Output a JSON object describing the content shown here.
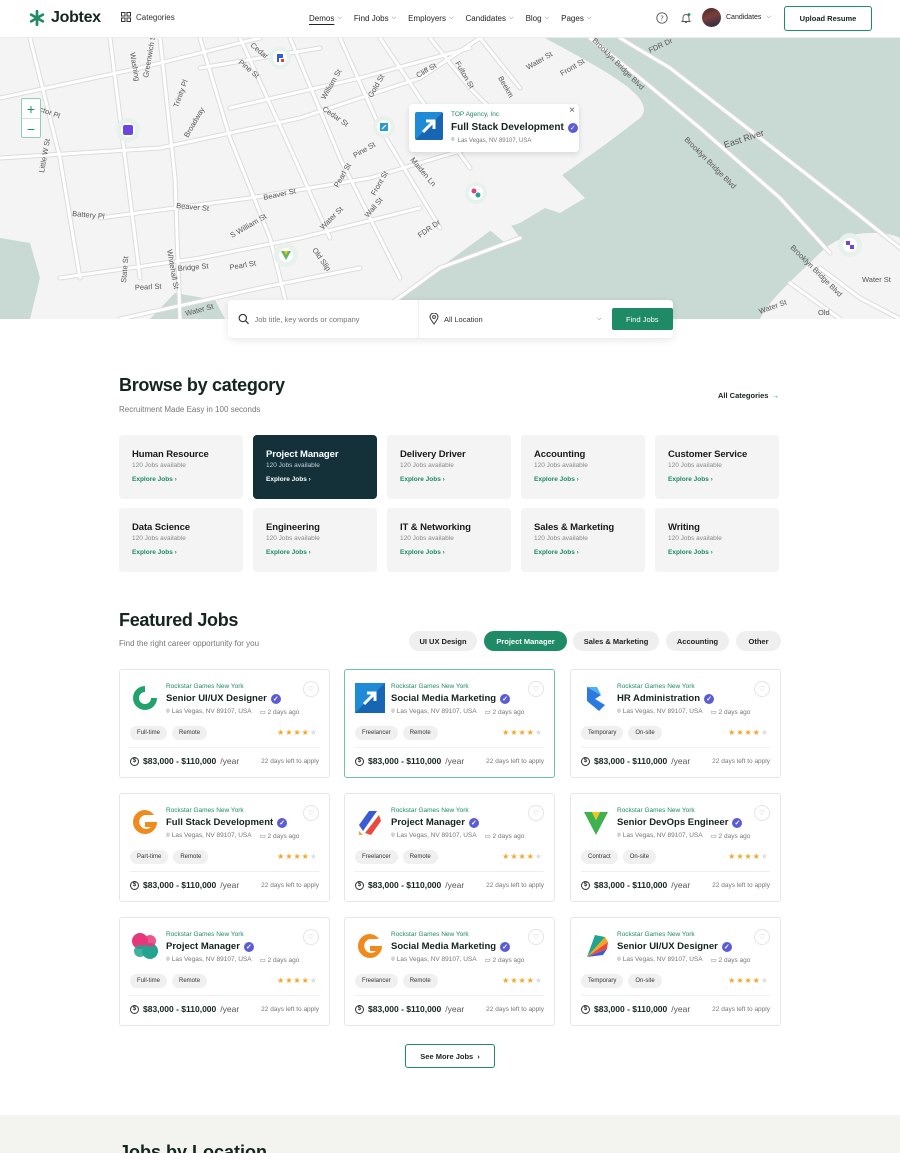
{
  "header": {
    "logo_text": "Jobtex",
    "categories_label": "Categories",
    "nav": [
      {
        "label": "Demos"
      },
      {
        "label": "Find Jobs"
      },
      {
        "label": "Employers"
      },
      {
        "label": "Candidates"
      },
      {
        "label": "Blog"
      },
      {
        "label": "Pages"
      }
    ],
    "user_label": "Candidates",
    "upload_button": "Upload Resume",
    "icons": {
      "categories": "grid-icon",
      "help": "question-circle-icon",
      "bell": "bell-icon",
      "avatar": "user-avatar"
    }
  },
  "map": {
    "popup": {
      "company": "TOP Agency, Inc",
      "title": "Full Stack Development",
      "location": "Las Vegas, NV 89107, USA"
    },
    "streets": [
      "Washing",
      "Greenwich St",
      "Trinity Pl",
      "Broadway",
      "Cedar",
      "Pine St",
      "William St",
      "Gold St",
      "Cliff St",
      "Fulton St",
      "Beekm",
      "Water St",
      "Front St",
      "FDR Dr",
      "Brooklyn Bridge Blvd",
      "East River",
      "Rector Pl",
      "Little W St",
      "Battery Pl",
      "Beaver St",
      "S William St",
      "Whitehall St",
      "Bridge St",
      "Pearl St",
      "State St",
      "Old Slip",
      "Wall St",
      "Maiden Ln",
      "Water St",
      "Pearl St",
      "Cedar St",
      "Pine St",
      "Brooklyn Bridge Blvd",
      "Water St",
      "Old",
      "Beaver St",
      "Water St",
      "Front St",
      "FDR Dr",
      "Pearl St",
      "Brooklyn Bridge Blvd",
      "Water St"
    ],
    "zoom_in": "+",
    "zoom_out": "−"
  },
  "search": {
    "placeholder": "Job title, key words or company",
    "location": "All Location",
    "button": "Find Jobs"
  },
  "browse": {
    "title": "Browse by category",
    "subtitle": "Recruitment Made Easy in 100 seconds",
    "all_link": "All Categories",
    "categories": [
      {
        "title": "Human Resource",
        "count": "120 Jobs available",
        "link": "Explore Jobs"
      },
      {
        "title": "Project Manager",
        "count": "120 Jobs available",
        "link": "Explore Jobs"
      },
      {
        "title": "Delivery Driver",
        "count": "120 Jobs available",
        "link": "Explore Jobs"
      },
      {
        "title": "Accounting",
        "count": "120 Jobs available",
        "link": "Explore Jobs"
      },
      {
        "title": "Customer Service",
        "count": "120 Jobs available",
        "link": "Explore Jobs"
      },
      {
        "title": "Data Science",
        "count": "120 Jobs available",
        "link": "Explore Jobs"
      },
      {
        "title": "Engineering",
        "count": "120 Jobs available",
        "link": "Explore Jobs"
      },
      {
        "title": "IT & Networking",
        "count": "120 Jobs available",
        "link": "Explore Jobs"
      },
      {
        "title": "Sales & Marketing",
        "count": "120 Jobs available",
        "link": "Explore Jobs"
      },
      {
        "title": "Writing",
        "count": "120 Jobs available",
        "link": "Explore Jobs"
      }
    ]
  },
  "featured": {
    "title": "Featured Jobs",
    "subtitle": "Find the right career opportunity for you",
    "filters": [
      "UI UX Design",
      "Project Manager",
      "Sales & Marketing",
      "Accounting",
      "Other"
    ],
    "jobs": [
      {
        "company": "Rockstar Games New York",
        "title": "Senior UI/UX Designer",
        "location": "Las Vegas, NV 89107, USA",
        "posted": "2 days ago",
        "tags": [
          "Full-time",
          "Remote"
        ],
        "salary": "$83,000 - $110,000",
        "per": "/year",
        "left": "22 days left to apply",
        "logo": "green-swirl-logo",
        "rating": 4
      },
      {
        "company": "Rockstar Games New York",
        "title": "Social Media Marketing",
        "location": "Las Vegas, NV 89107, USA",
        "posted": "2 days ago",
        "tags": [
          "Freelancer",
          "Remote"
        ],
        "salary": "$83,000 - $110,000",
        "per": "/year",
        "left": "22 days left to apply",
        "logo": "blue-arrow-logo",
        "rating": 4
      },
      {
        "company": "Rockstar Games New York",
        "title": "HR Administration",
        "location": "Las Vegas, NV 89107, USA",
        "posted": "2 days ago",
        "tags": [
          "Temporary",
          "On-site"
        ],
        "salary": "$83,000 - $110,000",
        "per": "/year",
        "left": "22 days left to apply",
        "logo": "blue-chevron-logo",
        "rating": 4
      },
      {
        "company": "Rockstar Games New York",
        "title": "Full Stack Development",
        "location": "Las Vegas, NV 89107, USA",
        "posted": "2 days ago",
        "tags": [
          "Part-time",
          "Remote"
        ],
        "salary": "$83,000 - $110,000",
        "per": "/year",
        "left": "22 days left to apply",
        "logo": "orange-g-logo",
        "rating": 4
      },
      {
        "company": "Rockstar Games New York",
        "title": "Project Manager",
        "location": "Las Vegas, NV 89107, USA",
        "posted": "2 days ago",
        "tags": [
          "Freelancer",
          "Remote"
        ],
        "salary": "$83,000 - $110,000",
        "per": "/year",
        "left": "22 days left to apply",
        "logo": "stripes-logo",
        "rating": 4
      },
      {
        "company": "Rockstar Games New York",
        "title": "Senior DevOps Engineer",
        "location": "Las Vegas, NV 89107, USA",
        "posted": "2 days ago",
        "tags": [
          "Contract",
          "On-site"
        ],
        "salary": "$83,000 - $110,000",
        "per": "/year",
        "left": "22 days left to apply",
        "logo": "green-y-logo",
        "rating": 4
      },
      {
        "company": "Rockstar Games New York",
        "title": "Project Manager",
        "location": "Las Vegas, NV 89107, USA",
        "posted": "2 days ago",
        "tags": [
          "Full-time",
          "Remote"
        ],
        "salary": "$83,000 - $110,000",
        "per": "/year",
        "left": "22 days left to apply",
        "logo": "pink-x-logo",
        "rating": 4
      },
      {
        "company": "Rockstar Games New York",
        "title": "Social Media Marketing",
        "location": "Las Vegas, NV 89107, USA",
        "posted": "2 days ago",
        "tags": [
          "Freelancer",
          "Remote"
        ],
        "salary": "$83,000 - $110,000",
        "per": "/year",
        "left": "22 days left to apply",
        "logo": "orange-g-logo",
        "rating": 4
      },
      {
        "company": "Rockstar Games New York",
        "title": "Senior UI/UX Designer",
        "location": "Las Vegas, NV 89107, USA",
        "posted": "2 days ago",
        "tags": [
          "Temporary",
          "On-site"
        ],
        "salary": "$83,000 - $110,000",
        "per": "/year",
        "left": "22 days left to apply",
        "logo": "fan-logo",
        "rating": 4
      }
    ],
    "see_more": "See More Jobs"
  },
  "location_section": {
    "title": "Jobs by Location"
  },
  "colors": {
    "accent": "#1e8a66",
    "dark": "#14313a",
    "verified": "#5b5bd6",
    "star": "#f5a524",
    "water": "#c9d9d4"
  }
}
